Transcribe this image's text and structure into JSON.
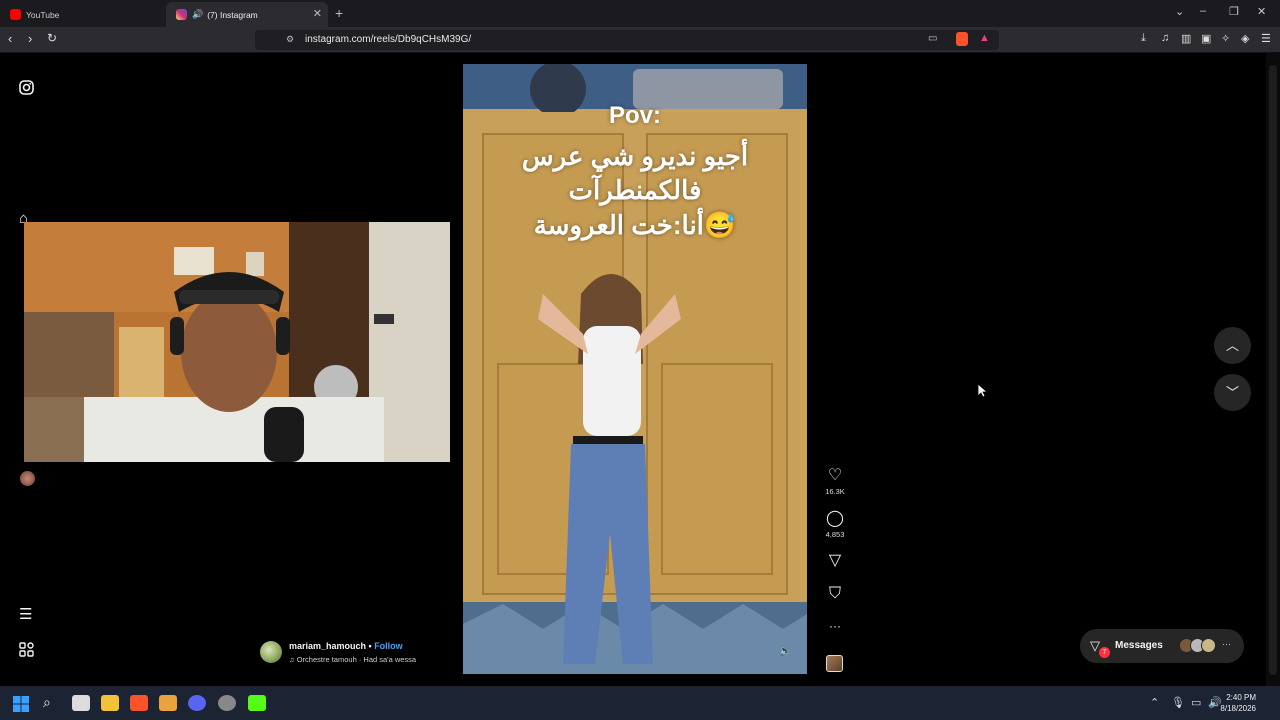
{
  "browser": {
    "tabs": [
      {
        "title": "YouTube",
        "active": false,
        "favicon_color": "#ff0000"
      },
      {
        "title": "(7) Instagram",
        "active": true,
        "favicon_color": "#e1306c"
      }
    ],
    "new_tab_label": "+",
    "url": "instagram.com/reels/Db9qCHsM39G/"
  },
  "instagram": {
    "sidebar_icons": [
      "instagram-logo-icon",
      "home-icon",
      "reels-icon",
      "explore-icon",
      "search-icon",
      "messages-icon",
      "create-icon",
      "profile-icon",
      "more-menu-icon",
      "also-from-meta-icon"
    ],
    "reel": {
      "caption_lines": [
        "Pov:",
        "أجيو نديرو شي عرس",
        "فالكمنطرآت",
        "أنا:خت العروسة😅"
      ],
      "likes": "16.3K",
      "comments": "4,853",
      "author": {
        "username": "mariam_hamouch",
        "separator": " • ",
        "follow_label": "Follow",
        "audio": "♫ Orchestre tamouh · Had sa'a wessa"
      }
    },
    "messages": {
      "label": "Messages",
      "unread": "7"
    }
  },
  "taskbar": {
    "time": "2:40 PM",
    "date": "8/18/2026"
  },
  "colors": {
    "accent": "#4aa3f0",
    "badge": "#ff3040"
  }
}
